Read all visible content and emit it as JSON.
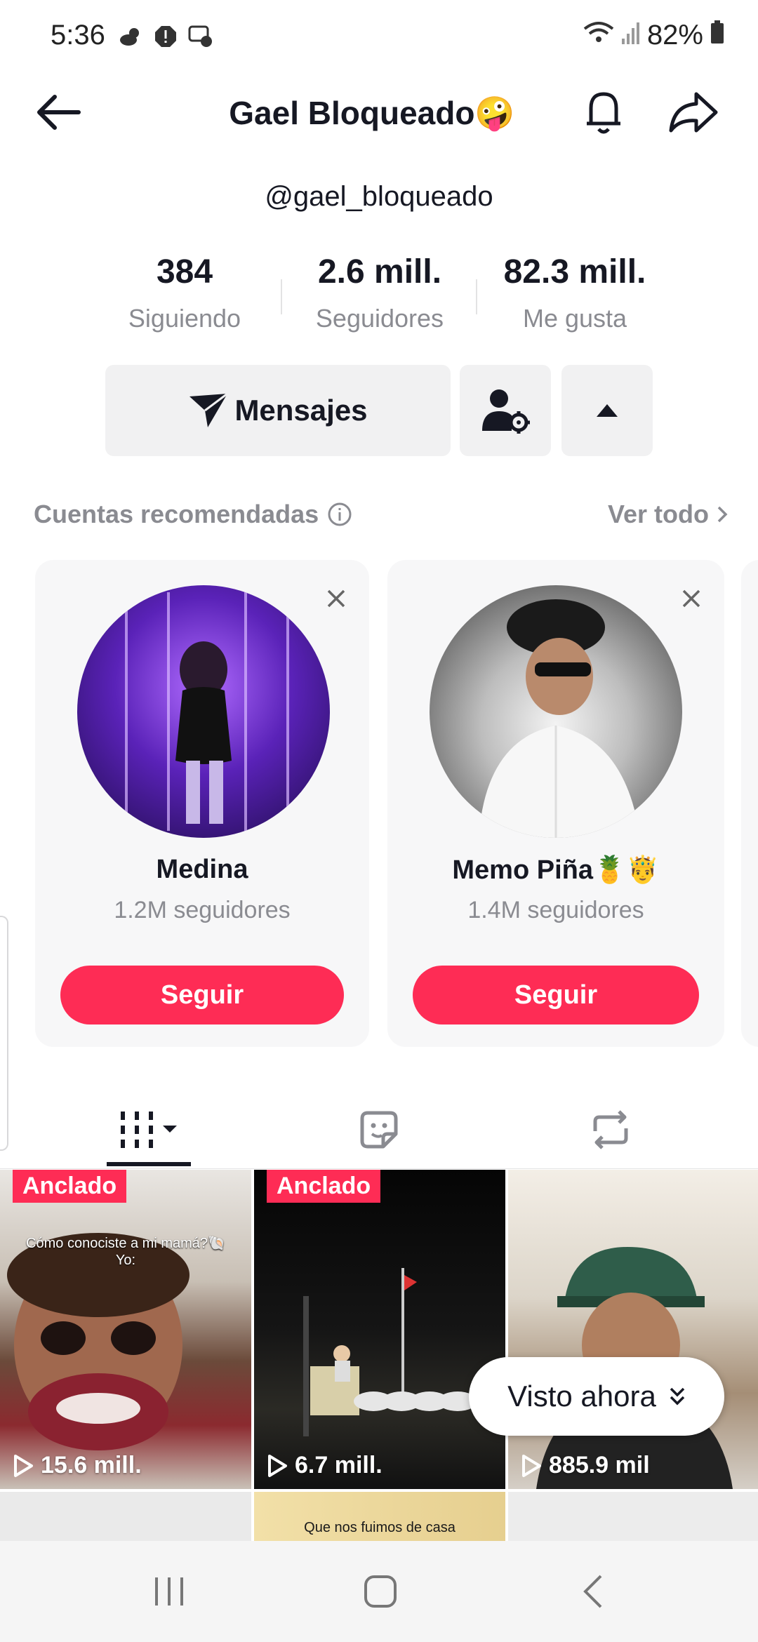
{
  "status_bar": {
    "time": "5:36",
    "battery": "82%"
  },
  "header": {
    "title": "Gael Bloqueado🤪"
  },
  "profile": {
    "username": "@gael_bloqueado"
  },
  "stats": [
    {
      "value": "384",
      "label": "Siguiendo"
    },
    {
      "value": "2.6 mill.",
      "label": "Seguidores"
    },
    {
      "value": "82.3 mill.",
      "label": "Me gusta"
    }
  ],
  "actions": {
    "message_label": "Mensajes"
  },
  "recommended": {
    "title": "Cuentas recomendadas",
    "see_all": "Ver todo",
    "cards": [
      {
        "name": "Medina",
        "followers": "1.2M seguidores",
        "button": "Seguir"
      },
      {
        "name": "Memo Piña🍍🤴",
        "followers": "1.4M seguidores",
        "button": "Seguir"
      }
    ]
  },
  "videos": [
    {
      "pinned": "Anclado",
      "views": "15.6 mill.",
      "caption_line1": "Cómo conociste a mi mamá?🐚",
      "caption_line2": "Yo:"
    },
    {
      "pinned": "Anclado",
      "views": "6.7 mill."
    },
    {
      "views": "885.9 mil"
    },
    {
      "caption": "Que nos fuimos de casa"
    }
  ],
  "seen_pill": {
    "label": "Visto ahora"
  },
  "colors": {
    "accent": "#fe2c55",
    "text": "#161823",
    "muted": "#8a8b91",
    "button_bg": "#f1f1f2"
  },
  "icons": [
    "back-arrow-icon",
    "bell-icon",
    "share-icon",
    "send-icon",
    "add-friend-gear-icon",
    "caret-up-icon",
    "info-icon",
    "chevron-right-icon",
    "close-icon",
    "grid-icon",
    "sticker-icon",
    "repost-icon",
    "play-icon",
    "double-chevron-down-icon"
  ]
}
